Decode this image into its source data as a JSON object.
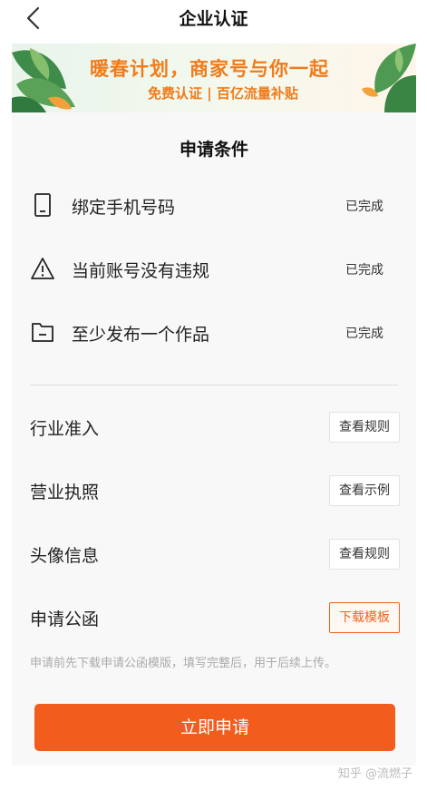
{
  "header": {
    "title": "企业认证",
    "back_icon": "chevron-left-icon"
  },
  "banner": {
    "title": "暖春计划，商家号与你一起",
    "subtitle": "免费认证 | 百亿流量补贴",
    "accent_color": "#f07b1a"
  },
  "conditions": {
    "title": "申请条件",
    "items": [
      {
        "icon": "phone-icon",
        "label": "绑定手机号码",
        "status": "已完成"
      },
      {
        "icon": "warning-icon",
        "label": "当前账号没有违规",
        "status": "已完成"
      },
      {
        "icon": "folder-icon",
        "label": "至少发布一个作品",
        "status": "已完成"
      }
    ]
  },
  "requirements": {
    "items": [
      {
        "label": "行业准入",
        "button": "查看规则"
      },
      {
        "label": "营业执照",
        "button": "查看示例"
      },
      {
        "label": "头像信息",
        "button": "查看规则"
      },
      {
        "label": "申请公函",
        "button": "下载模板"
      }
    ],
    "hint": "申请前先下载申请公函模版，填写完整后，用于后续上传。"
  },
  "apply_button": {
    "label": "立即申请",
    "color": "#f25d1e"
  },
  "watermark": "知乎 @流燃子"
}
